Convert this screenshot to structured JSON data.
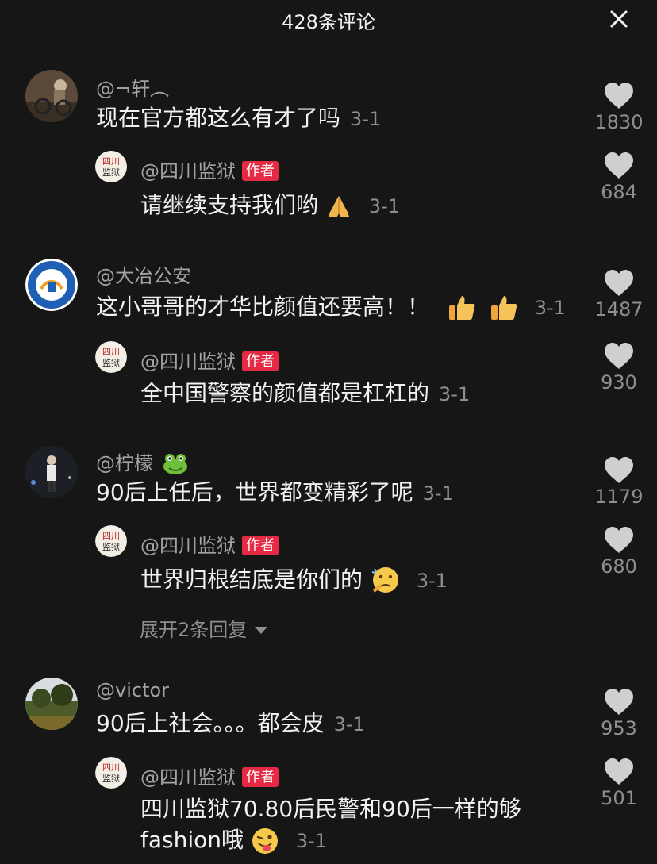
{
  "header": {
    "title": "428条评论",
    "close_icon": "close-icon"
  },
  "comments": [
    {
      "user": "@¬轩︵",
      "text": "现在官方都这么有才了吗",
      "date": "3-1",
      "likes": "1830",
      "reply": {
        "user": "@四川监狱",
        "tag": "作者",
        "text": "请继续支持我们哟",
        "date": "3-1",
        "likes": "684"
      }
    },
    {
      "user": "@大冶公安",
      "text": "这小哥哥的才华比颜值还要高！！",
      "date": "3-1",
      "likes": "1487",
      "reply": {
        "user": "@四川监狱",
        "tag": "作者",
        "text": "全中国警察的颜值都是杠杠的",
        "date": "3-1",
        "likes": "930"
      }
    },
    {
      "user": "@柠檬",
      "text": "90后上任后，世界都变精彩了呢",
      "date": "3-1",
      "likes": "1179",
      "reply": {
        "user": "@四川监狱",
        "tag": "作者",
        "text": "世界归根结底是你们的",
        "date": "3-1",
        "likes": "680"
      },
      "expand": "展开2条回复"
    },
    {
      "user": "@victor",
      "text": "90后上社会。。。都会皮",
      "date": "3-1",
      "likes": "953",
      "reply": {
        "user": "@四川监狱",
        "tag": "作者",
        "text_line1": "四川监狱70.80后民警和90后一样的够",
        "text_line2": "fashion哦",
        "date": "3-1",
        "likes": "501"
      }
    }
  ],
  "seal_text": "四川监狱",
  "colors": {
    "background": "#161616",
    "author_tag": "#e52b44",
    "secondary_text": "#8f8f8f",
    "like_icon": "#cfcfcf"
  }
}
